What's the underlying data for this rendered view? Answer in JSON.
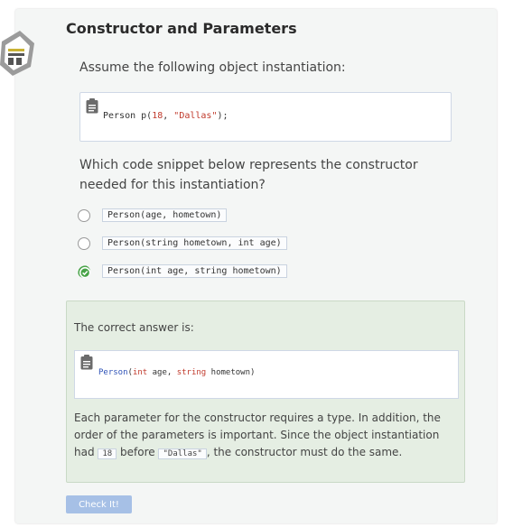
{
  "page": {
    "title": "Constructor and Parameters",
    "prompt": "Assume the following object instantiation:",
    "code_sample": {
      "class_name": "Person p",
      "open": "(",
      "num": "18",
      "sep": ", ",
      "str": "\"Dallas\"",
      "close": ");"
    },
    "question": "Which code snippet below represents the constructor needed for this instantiation?"
  },
  "options": [
    {
      "label": "Person(age, hometown)",
      "selected": false
    },
    {
      "label": "Person(string hometown, int age)",
      "selected": false
    },
    {
      "label": "Person(int age, string hometown)",
      "selected": true
    }
  ],
  "answer": {
    "label": "The correct answer is:",
    "code": {
      "name": "Person",
      "open": "(",
      "t1": "int",
      "p1": " age, ",
      "t2": "string",
      "p2": " hometown)"
    },
    "explanation": {
      "part1": "Each parameter for the constructor requires a type. In addition, the order of the parameters is important. Since the object instantiation had ",
      "code1": "18",
      "part2": " before ",
      "code2": "\"Dallas\"",
      "part3": ", the constructor must do the same."
    }
  },
  "check_button": {
    "label": "Check It!"
  },
  "colors": {
    "accent_green": "#47a347",
    "button_blue": "#a6c0e6",
    "answer_bg": "#e5eee3"
  }
}
